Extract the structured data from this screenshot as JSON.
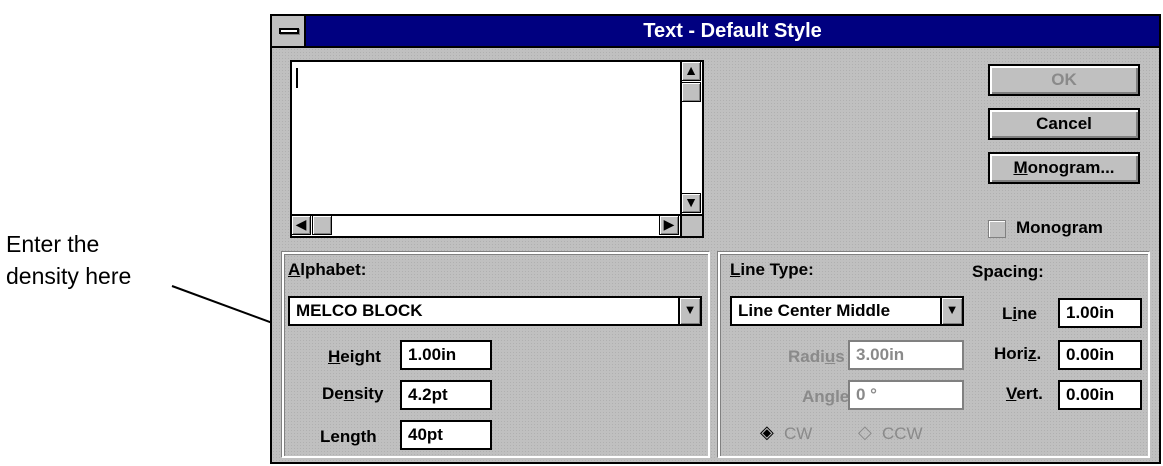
{
  "callout": {
    "line1": "Enter the",
    "line2": "density here"
  },
  "window": {
    "title": "Text - Default Style"
  },
  "text_input": {
    "value": ""
  },
  "buttons": {
    "ok": "OK",
    "cancel": "Cancel",
    "monogram_mn": "M",
    "monogram_rest": "onogram..."
  },
  "monogram_checkbox": {
    "label": "Monogram",
    "checked": false
  },
  "alphabet": {
    "label_mn": "A",
    "label_rest": "lphabet:",
    "value": "MELCO BLOCK",
    "height_mn": "H",
    "height_rest": "eight",
    "height_value": "1.00in",
    "density_pre": "De",
    "density_mn": "n",
    "density_post": "sity",
    "density_value": "4.2pt",
    "length_label": "Length",
    "length_value": "40pt"
  },
  "line_type": {
    "label_mn": "L",
    "label_rest": "ine Type:",
    "value": "Line Center Middle",
    "radius_pre": "Radi",
    "radius_mn": "u",
    "radius_post": "s",
    "radius_value": "3.00in",
    "angle_pre": "An",
    "angle_mn": "g",
    "angle_post": "le",
    "angle_value": "0 °",
    "cw": "CW",
    "ccw": "CCW"
  },
  "spacing": {
    "label": "Spacing:",
    "line_pre": "L",
    "line_mn": "i",
    "line_post": "ne",
    "line_value": "1.00in",
    "horiz_pre": "Hori",
    "horiz_mn": "z",
    "horiz_post": ".",
    "horiz_value": "0.00in",
    "vert_mn": "V",
    "vert_rest": "ert.",
    "vert_value": "0.00in"
  },
  "colors": {
    "titlebar": "#000080",
    "face": "#c0c0c0",
    "disabled_text": "#8a8a8a"
  }
}
